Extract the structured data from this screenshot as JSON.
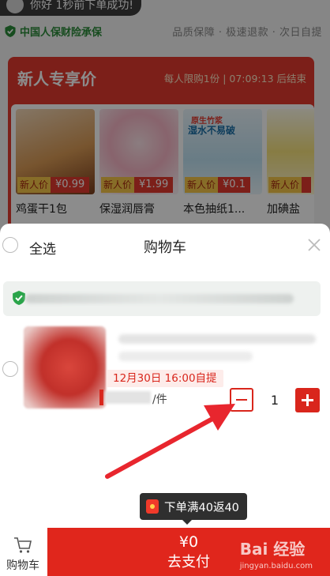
{
  "background": {
    "toast": "你好 1秒前下单成功!",
    "guarantee_left": "中国人保财险承保",
    "guarantee_right": "品质保障 · 极速退款 · 次日自提",
    "promo": {
      "title": "新人专享价",
      "subtitle": "每人限购1份 | 07:09:13 后结束",
      "products": [
        {
          "name": "鸡蛋干1包",
          "tag": "新人价",
          "price": "¥0.99"
        },
        {
          "name": "保湿润唇膏",
          "tag": "新人价",
          "price": "¥1.99"
        },
        {
          "name": "本色抽纸1...",
          "tag": "新人价",
          "price": "¥0.1",
          "img_text1": "原生竹浆",
          "img_text2": "湿水不易破"
        },
        {
          "name": "加碘盐",
          "tag": "新人价",
          "price": ""
        }
      ]
    }
  },
  "cart": {
    "select_all": "全选",
    "title": "购物车",
    "item": {
      "pickup": "12月30日 16:00自提",
      "unit": "/件",
      "quantity": "1"
    }
  },
  "bottom": {
    "tooltip": "下单满40返40",
    "cart_tab": "购物车",
    "amount": "¥0",
    "pay": "去支付"
  },
  "watermark": {
    "main": "Bai 经验",
    "sub": "jingyan.baidu.com"
  },
  "icons": {
    "shield": "shield-check-icon",
    "close": "close-icon",
    "cart": "cart-icon",
    "red_packet": "red-packet-icon",
    "arrow": "annotation-arrow"
  },
  "colors": {
    "accent": "#e0261c",
    "promo_bg": "#e23a2e",
    "guarantee": "#2a8a3a"
  }
}
